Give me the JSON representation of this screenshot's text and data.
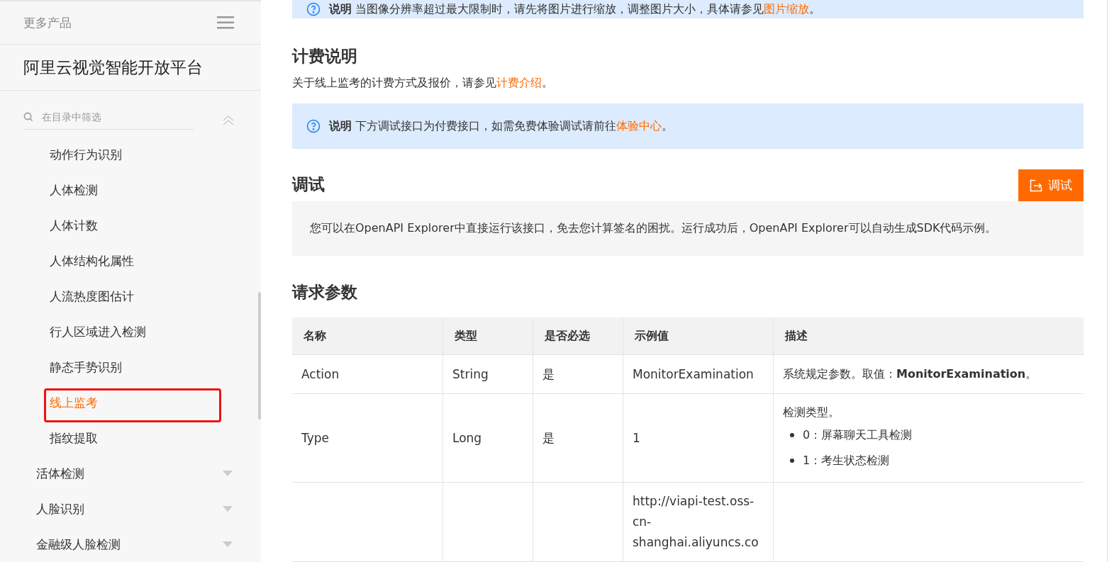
{
  "sidebar": {
    "more_products": "更多产品",
    "platform_title": "阿里云视觉智能开放平台",
    "filter": {
      "placeholder": "在目录中筛选"
    },
    "sub_items": [
      {
        "label": "动作行为识别",
        "selected": false,
        "marked": false
      },
      {
        "label": "人体检测",
        "selected": false,
        "marked": false
      },
      {
        "label": "人体计数",
        "selected": false,
        "marked": false
      },
      {
        "label": "人体结构化属性",
        "selected": false,
        "marked": false
      },
      {
        "label": "人流热度图估计",
        "selected": false,
        "marked": false
      },
      {
        "label": "行人区域进入检测",
        "selected": false,
        "marked": false
      },
      {
        "label": "静态手势识别",
        "selected": false,
        "marked": false
      },
      {
        "label": "线上监考",
        "selected": true,
        "marked": true
      },
      {
        "label": "指纹提取",
        "selected": false,
        "marked": false
      }
    ],
    "groups": [
      {
        "label": "活体检测",
        "expanded": false
      },
      {
        "label": "人脸识别",
        "expanded": false
      },
      {
        "label": "金融级人脸检测",
        "expanded": false
      }
    ]
  },
  "top_note": {
    "label": "说明",
    "text": "当图像分辨率超过最大限制时，请先将图片进行缩放，调整图片大小，具体请参见",
    "link": "图片缩放",
    "end": "。"
  },
  "billing": {
    "heading": "计费说明",
    "text": "关于线上监考的计费方式及报价，请参见",
    "link": "计费介绍",
    "end": "。"
  },
  "debug_note": {
    "label": "说明",
    "text": "下方调试接口为付费接口，如需免费体验调试请前往",
    "link": "体验中心",
    "end": "。"
  },
  "debug": {
    "heading": "调试",
    "button": "调试",
    "text": "您可以在OpenAPI Explorer中直接运行该接口，免去您计算签名的困扰。运行成功后，OpenAPI Explorer可以自动生成SDK代码示例。"
  },
  "params": {
    "heading": "请求参数",
    "columns": [
      "名称",
      "类型",
      "是否必选",
      "示例值",
      "描述"
    ],
    "rows": [
      {
        "cells": [
          "Action",
          "String",
          "是",
          "MonitorExamination"
        ],
        "description": "系统规定参数。取值：**MonitorExamination**。",
        "bullets": []
      },
      {
        "cells": [
          "Type",
          "Long",
          "是",
          "1"
        ],
        "description": "检测类型。",
        "bullets": [
          "0：屏幕聊天工具检测",
          "1：考生状态检测"
        ]
      },
      {
        "cells": [
          "",
          "",
          "",
          "http://viapi-test.oss-cn-shanghai.aliyuncs.co"
        ],
        "description": "",
        "bullets": []
      }
    ]
  }
}
